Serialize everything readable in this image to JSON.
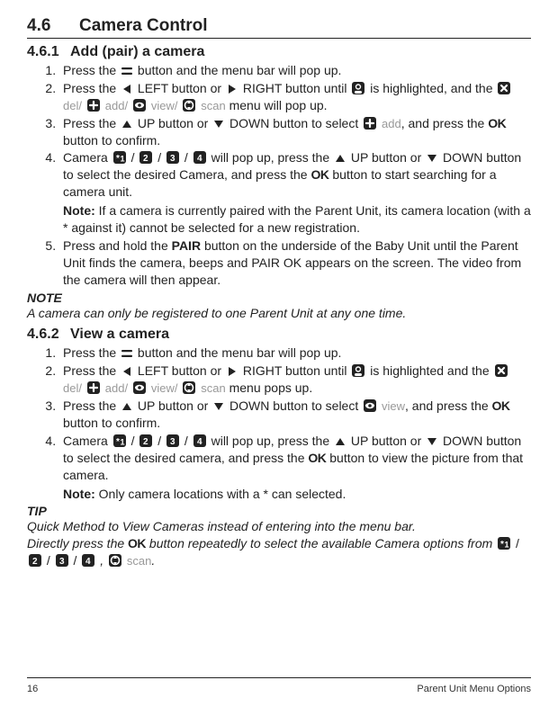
{
  "section": {
    "number": "4.6",
    "title": "Camera Control"
  },
  "sub1": {
    "number": "4.6.1",
    "title": "Add (pair) a camera",
    "step1_a": "Press the ",
    "step1_b": " button and the menu bar will pop up.",
    "step2_a": "Press the ",
    "step2_b": " LEFT button or ",
    "step2_c": " RIGHT button until ",
    "step2_d": " is highlighted, and the ",
    "step2_e": " menu will pop up.",
    "label_del": "del/",
    "label_add": "add/",
    "label_view": "view/",
    "label_scan": "scan",
    "step3_a": "Press the ",
    "step3_b": " UP button or ",
    "step3_c": " DOWN button to select ",
    "step3_d": ", and press the ",
    "step3_e": " button to confirm.",
    "step3_add": "add",
    "step4_a": "Camera ",
    "step4_b": " will pop up, press the ",
    "step4_c": " UP button or ",
    "step4_d": " DOWN button to select the desired Camera, and press the ",
    "step4_e": " button to start searching for a camera unit.",
    "step4_note_label": "Note:",
    "step4_note": " If a camera is currently paired with the Parent Unit, its camera location (with a * against it) cannot be selected for a new registration.",
    "step5_a": "Press and hold the ",
    "step5_pair": "PAIR",
    "step5_b": " button on the underside of the Baby Unit until the Parent Unit finds the camera, beeps and PAIR OK appears on the screen. The video from the camera will then appear.",
    "note_heading": "NOTE",
    "note_text": "A camera can only be registered to one Parent Unit at any one time."
  },
  "sub2": {
    "number": "4.6.2",
    "title": "View a camera",
    "step1_a": "Press the ",
    "step1_b": " button and the menu bar will pop up.",
    "step2_a": "Press the ",
    "step2_b": " LEFT button or ",
    "step2_c": " RIGHT button until ",
    "step2_d": " is highlighted and the ",
    "step2_e": " menu pops up.",
    "step3_a": "Press the ",
    "step3_b": " UP button or ",
    "step3_c": " DOWN button to select ",
    "step3_d": ", and press the ",
    "step3_e": " button to confirm.",
    "step3_view": "view",
    "step4_a": "Camera ",
    "step4_b": " will pop up, press the ",
    "step4_c": " UP button or ",
    "step4_d": " DOWN button to select the desired camera, and press the  ",
    "step4_e": " button to view the picture from that camera.",
    "step4_note_label": "Note:",
    "step4_note": " Only camera locations with a * can selected.",
    "tip_heading": "TIP",
    "tip_line1": "Quick Method to View Cameras instead of entering into the menu bar.",
    "tip_line2a": "Directly press the ",
    "tip_line2b": " button repeatedly to select the available Camera options from ",
    "tip_line2c": " , ",
    "tip_line2d": "."
  },
  "ok_label": "OK",
  "footer": {
    "page": "16",
    "section": "Parent Unit Menu Options"
  }
}
